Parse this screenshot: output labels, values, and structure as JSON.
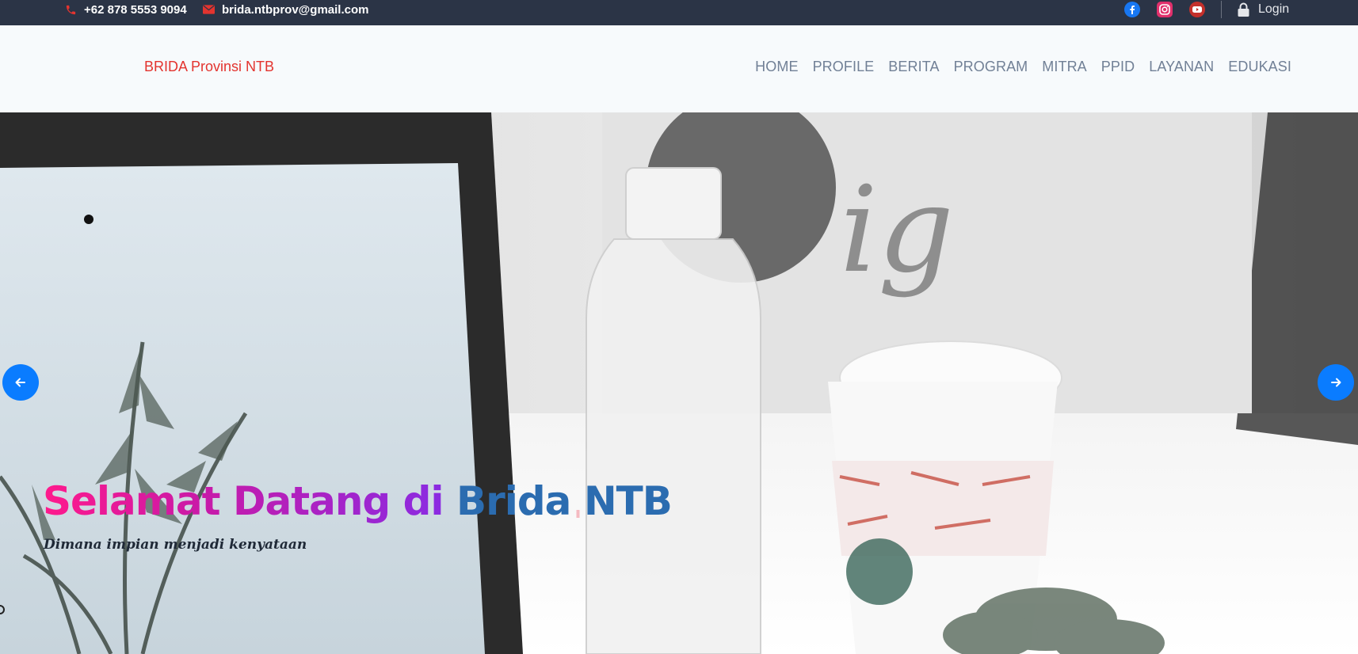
{
  "topbar": {
    "phone": "+62 878 5553 9094",
    "email": "brida.ntbprov@gmail.com",
    "social": [
      "facebook-icon",
      "instagram-icon",
      "youtube-icon"
    ],
    "login_label": "Login"
  },
  "header": {
    "brand": "BRIDA Provinsi NTB",
    "nav": [
      "HOME",
      "PROFILE",
      "BERITA",
      "PROGRAM",
      "MITRA",
      "PPID",
      "LAYANAN",
      "EDUKASI"
    ]
  },
  "hero": {
    "title_part1": "Selamat Datang di",
    "title_part2": "Brida NTB",
    "subtitle": "Dimana impian menjadi kenyataan"
  },
  "colors": {
    "topbar_bg": "#2b3446",
    "accent_red": "#e3342f",
    "nav_text": "#718096",
    "arrow_blue": "#0a7cff",
    "title_pink": "#ff1a8c",
    "title_purple": "#8a2be2",
    "title_blue": "#2b6cb0"
  }
}
